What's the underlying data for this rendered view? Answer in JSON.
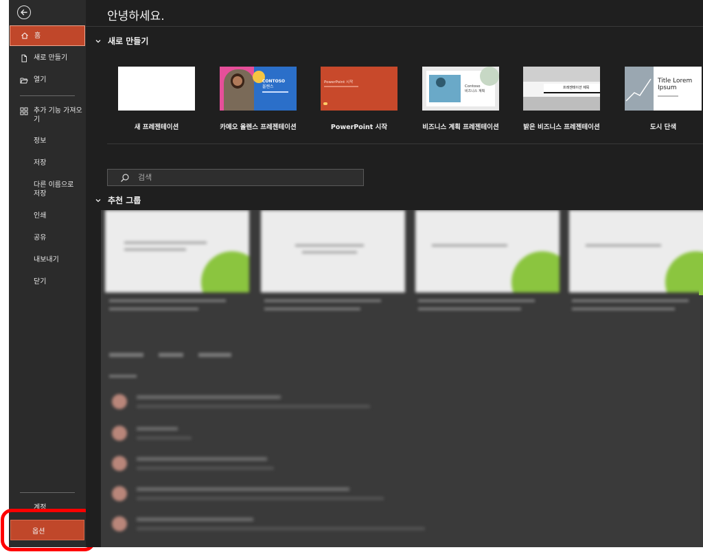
{
  "sidebar": {
    "home_label": "홈",
    "new_label": "새로 만들기",
    "open_label": "열기",
    "addins_label": "추가 기능 가져오기",
    "info_label": "정보",
    "save_label": "저장",
    "saveas_label": "다른 이름으로 저장",
    "print_label": "인쇄",
    "share_label": "공유",
    "export_label": "내보내기",
    "close_label": "닫기",
    "account_label": "계정",
    "options_label": "옵션"
  },
  "main": {
    "greeting": "안녕하세요.",
    "new_section_title": "새로 만들기",
    "templates": [
      {
        "label": "새 프레젠테이션"
      },
      {
        "label": "카메오 올렌스 프레젠테이션",
        "thumb_title": "CONTOSO",
        "thumb_sub": "올렌스"
      },
      {
        "label": "PowerPoint 시작",
        "thumb_title": "PowerPoint 시작"
      },
      {
        "label": "비즈니스 계획 프레젠테이션",
        "thumb_title": "Contoso",
        "thumb_sub": "비즈니스 계획"
      },
      {
        "label": "밝은 비즈니스 프레젠테이션",
        "thumb_title": "프레젠테이션 제목"
      },
      {
        "label": "도시 단색",
        "thumb_title": "Title Lorem Ipsum"
      }
    ],
    "search_placeholder": "검색",
    "featured_section_title": "추천 그룹"
  },
  "colors": {
    "accent": "#c0472a",
    "sidebar_bg": "#2b2b2b",
    "main_bg": "#1f1f1f",
    "highlight": "#ff0000"
  }
}
